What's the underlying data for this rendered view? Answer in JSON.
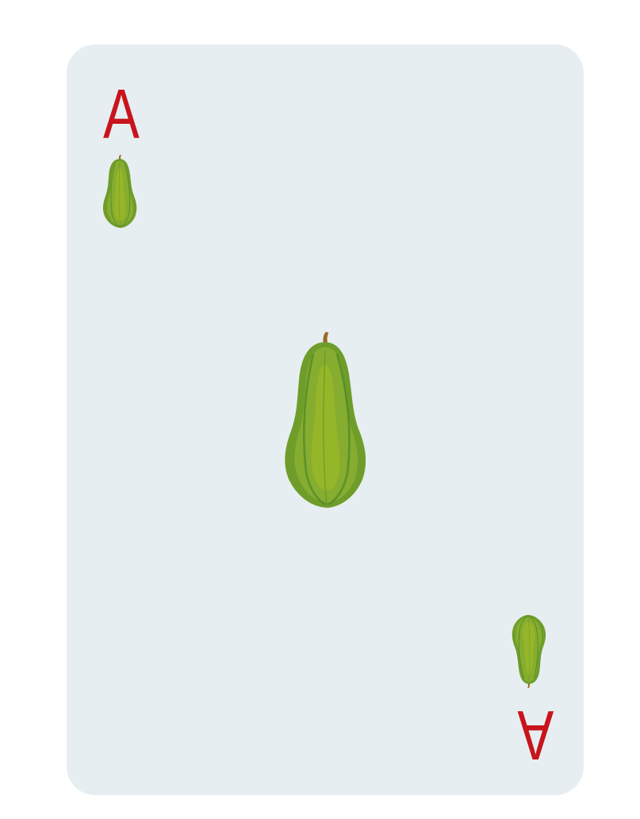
{
  "card": {
    "rank": "A",
    "suit_icon": "papaya-icon",
    "colors": {
      "card_background": "#e7eef1",
      "page_background": "#ffffff",
      "rank_color": "#c8141c",
      "fruit_outer": "#6f9d2a",
      "fruit_mid": "#86ad2f",
      "fruit_inner": "#9ab828",
      "fruit_rib": "#4f8a2a",
      "stem": "#9a6a1e"
    }
  }
}
